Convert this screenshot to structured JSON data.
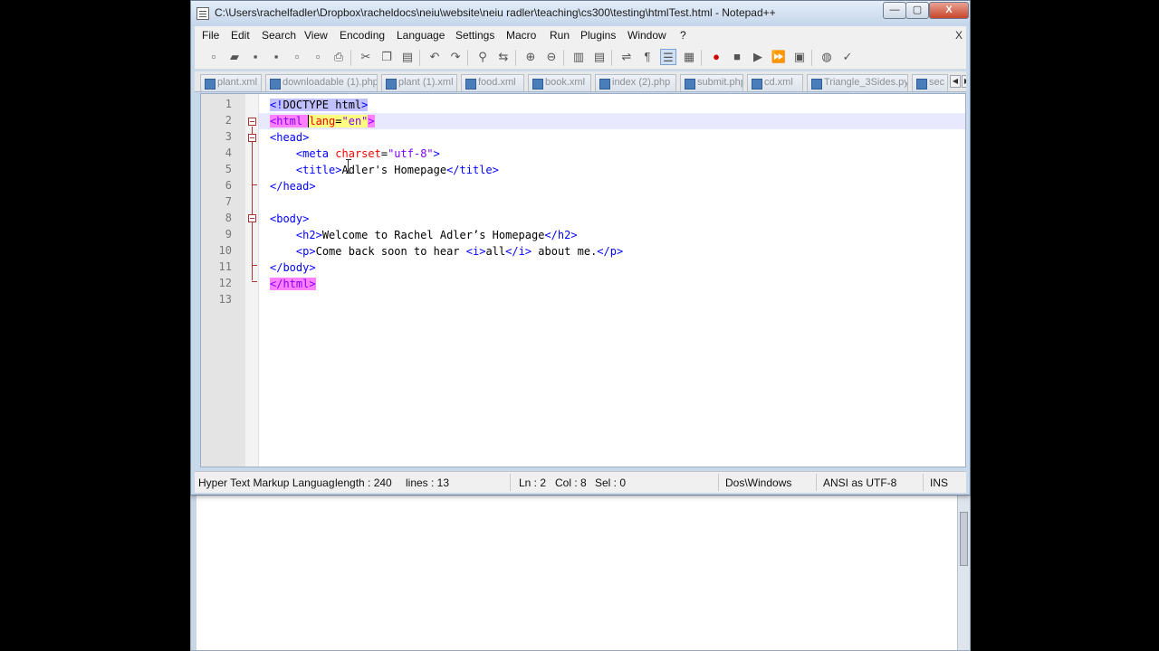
{
  "window": {
    "title": "C:\\Users\\rachelfadler\\Dropbox\\racheldocs\\neiu\\website\\neiu radler\\teaching\\cs300\\testing\\htmlTest.html - Notepad++",
    "controls": {
      "minimize": "—",
      "maximize": "▢",
      "close": "X"
    }
  },
  "menu": {
    "items": [
      "File",
      "Edit",
      "Search",
      "View",
      "Encoding",
      "Language",
      "Settings",
      "Macro",
      "Run",
      "Plugins",
      "Window",
      "?"
    ],
    "close_doc": "X"
  },
  "toolbar": {
    "icons": [
      "new-file-icon",
      "open-file-icon",
      "save-icon",
      "save-all-icon",
      "close-icon",
      "close-all-icon",
      "print-icon",
      "cut-icon",
      "copy-icon",
      "paste-icon",
      "undo-icon",
      "redo-icon",
      "find-icon",
      "replace-icon",
      "zoom-in-icon",
      "zoom-out-icon",
      "sync-vertical-icon",
      "sync-horizontal-icon",
      "word-wrap-icon",
      "show-all-chars-icon",
      "indent-guide-icon",
      "doc-map-icon",
      "record-macro-icon",
      "stop-macro-icon",
      "play-macro-icon",
      "run-macro-multiple-icon",
      "save-macro-icon",
      "launch-browser-icon",
      "spell-check-icon"
    ]
  },
  "tabs": [
    "plant.xml",
    "downloadable (1).php",
    "plant (1).xml",
    "food.xml",
    "book.xml",
    "index (2).php",
    "submit.php",
    "cd.xml",
    "Triangle_3Sides.py",
    "sec"
  ],
  "editor": {
    "line_numbers": [
      "1",
      "2",
      "3",
      "4",
      "5",
      "6",
      "7",
      "8",
      "9",
      "10",
      "11",
      "12",
      "13"
    ],
    "lines": {
      "l1_a": "<!",
      "l1_b": "DOCTYPE html",
      "l1_c": ">",
      "l2_tag": "<html",
      "l2_attr": "lang",
      "l2_eq": "=",
      "l2_val": "\"en\"",
      "l2_close": ">",
      "l3": "<head>",
      "l4_tag": "<meta",
      "l4_attr": "charset",
      "l4_eq": "=",
      "l4_val": "\"utf-8\"",
      "l4_close": ">",
      "l5_open": "<title>",
      "l5_text": "Adler's Homepage",
      "l5_close": "</title>",
      "l6": "</head>",
      "l8": "<body>",
      "l9_open": "<h2>",
      "l9_text": "Welcome to Rachel Adler’s Homepage",
      "l9_close": "</h2>",
      "l10_open": "<p>",
      "l10_text1": "Come back soon to hear ",
      "l10_i_open": "<i>",
      "l10_text2": "all",
      "l10_i_close": "</i>",
      "l10_text3": " about me.",
      "l10_close": "</p>",
      "l11": "</body>",
      "l12": "</html>"
    }
  },
  "status": {
    "language": "Hyper Text Markup Language",
    "length": "length : 240",
    "lines": "lines : 13",
    "ln": "Ln : 2",
    "col": "Col : 8",
    "sel": "Sel : 0",
    "eol": "Dos\\Windows",
    "encoding": "ANSI as UTF-8",
    "mode": "INS"
  }
}
